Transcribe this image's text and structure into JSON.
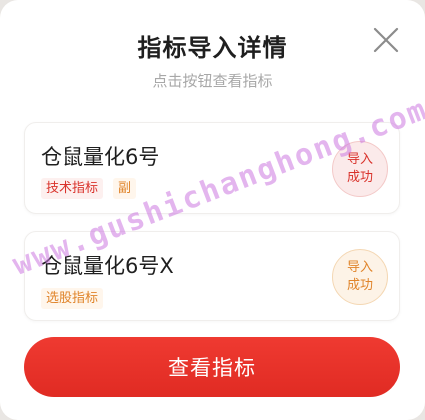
{
  "dialog": {
    "title": "指标导入详情",
    "subtitle": "点击按钮查看指标",
    "close_icon": "close-icon"
  },
  "cards": [
    {
      "name": "仓鼠量化6号",
      "tags": [
        {
          "label": "技术指标",
          "color": "#d9322b"
        },
        {
          "label": "副",
          "color": "#e0842a"
        }
      ],
      "status": {
        "line1": "导入",
        "line2": "成功",
        "color": "#d9322b"
      }
    },
    {
      "name": "仓鼠量化6号X",
      "tags": [
        {
          "label": "选股指标",
          "color": "#e0842a"
        }
      ],
      "status": {
        "line1": "导入",
        "line2": "成功",
        "color": "#e0842a"
      }
    }
  ],
  "primary_button": {
    "label": "查看指标",
    "color": "#e8302a"
  },
  "watermark": "www.gushichanghong.com"
}
